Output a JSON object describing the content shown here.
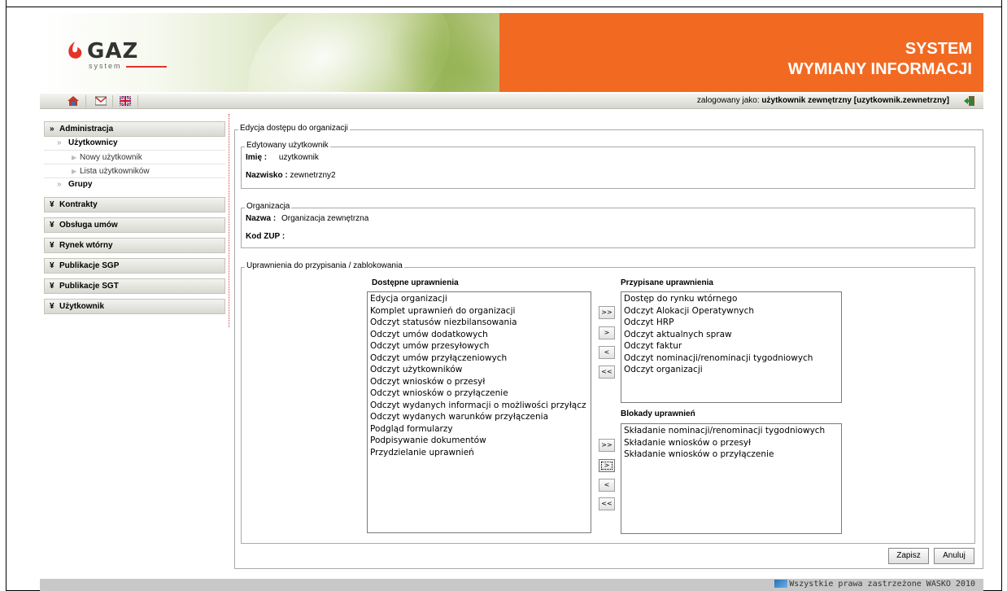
{
  "header": {
    "logo_word": "GAZ",
    "logo_sub": "system",
    "title_line1": "SYSTEM",
    "title_line2": "WYMIANY INFORMACJI",
    "brand_orange": "#f26a22"
  },
  "topbar": {
    "icons": [
      "home-icon",
      "mail-icon",
      "uk-flag-icon"
    ],
    "login_label": "zalogowany jako:",
    "login_user": "użytkownik zewnętrzny [uzytkownik.zewnetrzny]",
    "logout_icon": "logout-door-icon"
  },
  "sidebar": {
    "administracja": "Administracja",
    "uzytkownicy": "Użytkownicy",
    "nowy_uzytkownik": "Nowy użytkownik",
    "lista_uzytkownikow": "Lista użytkowników",
    "grupy": "Grupy",
    "kontrakty": "Kontrakty",
    "obsluga_umow": "Obsługa umów",
    "rynek_wtorny": "Rynek wtórny",
    "publikacje_sgp": "Publikacje SGP",
    "publikacje_sgt": "Publikacje SGT",
    "uzytkownik": "Użytkownik"
  },
  "main": {
    "legend": "Edycja dostępu do organizacji",
    "edited_user": {
      "legend": "Edytowany użytkownik",
      "imie_label": "Imię :",
      "imie_value": "uzytkownik",
      "nazwisko_label": "Nazwisko :",
      "nazwisko_value": "zewnetrzny2"
    },
    "organization": {
      "legend": "Organizacja",
      "nazwa_label": "Nazwa :",
      "nazwa_value": "Organizacja zewnętrzna",
      "kodzup_label": "Kod ZUP :"
    },
    "permissions": {
      "legend": "Uprawnienia do przypisania / zablokowania",
      "available_title": "Dostępne uprawnienia",
      "available": [
        "Edycja organizacji",
        "Komplet uprawnień do organizacji",
        "Odczyt statusów niezbilansowania",
        "Odczyt umów dodatkowych",
        "Odczyt umów przesyłowych",
        "Odczyt umów przyłączeniowych",
        "Odczyt użytkowników",
        "Odczyt wniosków o przesył",
        "Odczyt wniosków o przyłączenie",
        "Odczyt wydanych informacji o możliwości przyłącz",
        "Odczyt wydanych warunków przyłączenia",
        "Podgląd formularzy",
        "Podpisywanie dokumentów",
        "Przydzielanie uprawnień"
      ],
      "assigned_title": "Przypisane uprawnienia",
      "assigned": [
        "Dostęp do rynku wtórnego",
        "Odczyt Alokacji Operatywnych",
        "Odczyt HRP",
        "Odczyt aktualnych spraw",
        "Odczyt faktur",
        "Odczyt nominacji/renominacji tygodniowych",
        "Odczyt organizacji"
      ],
      "blocked_title": "Blokady uprawnień",
      "blocked": [
        "Składanie nominacji/renominacji tygodniowych",
        "Składanie wniosków o przesył",
        "Składanie wniosków o przyłączenie"
      ],
      "btn_all_right": ">>",
      "btn_right": ">",
      "btn_left": "<",
      "btn_all_left": "<<"
    },
    "save_label": "Zapisz",
    "cancel_label": "Anuluj"
  },
  "footer": {
    "text": "Wszystkie prawa zastrzeżone WASKO 2010"
  }
}
